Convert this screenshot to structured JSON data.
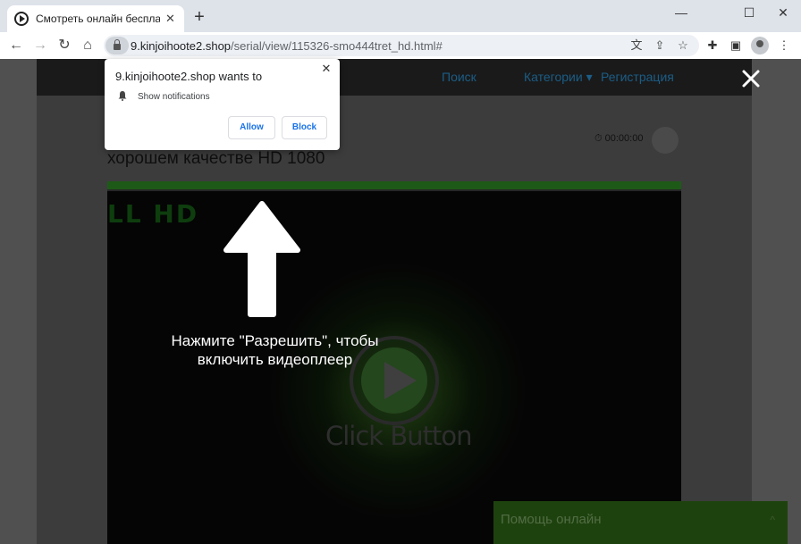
{
  "browser": {
    "tab_title": "Смотреть онлайн бесплатно в хорошем качестве",
    "tab_close": "✕",
    "new_tab": "+",
    "controls": {
      "minimize": "—",
      "maximize": "☐",
      "close": "✕"
    },
    "url_host": "9.kinjoihoote2.shop",
    "url_path": "/serial/view/115326-smo444tret_hd.html#"
  },
  "permission_popup": {
    "title": "9.kinjoihoote2.shop wants to",
    "permission": "Show notifications",
    "allow_label": "Allow",
    "block_label": "Block",
    "close": "✕"
  },
  "site": {
    "nav": {
      "search": "Поиск",
      "categories": "Категории ▾",
      "register": "Регистрация"
    },
    "heading": "хорошем качестве HD 1080",
    "timer": "⏱ 00:00:00",
    "player": {
      "hd_text": "LL HD",
      "click_button": "Click Button"
    },
    "instruction": "Нажмите \"Разрешить\", чтобы включить видеоплеер",
    "help": {
      "label": "Помощь онлайн",
      "chevron": "^"
    }
  },
  "colors": {
    "accent_green": "#1e5a17",
    "link_blue": "#1a73e8"
  }
}
